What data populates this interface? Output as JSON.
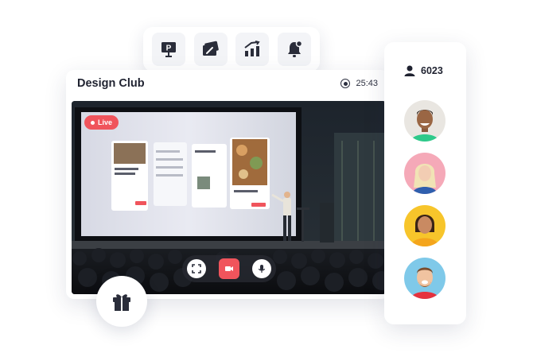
{
  "card": {
    "title": "Design Club",
    "timer": "25:43"
  },
  "live_badge": "Live",
  "viewers": {
    "count": "6023"
  },
  "toolbar": {
    "items": [
      {
        "icon": "presentation-icon"
      },
      {
        "icon": "whiteboard-draw-icon"
      },
      {
        "icon": "analytics-chart-icon"
      },
      {
        "icon": "notification-bell-icon"
      }
    ]
  },
  "controls": {
    "items": [
      {
        "icon": "fullscreen-icon"
      },
      {
        "icon": "video-camera-icon"
      },
      {
        "icon": "microphone-icon"
      }
    ]
  },
  "colors": {
    "accent": "#f0545c",
    "avatar_backgrounds": [
      "#2dc98a",
      "#f5a9b8",
      "#f7c52b",
      "#7fc9e9"
    ]
  }
}
